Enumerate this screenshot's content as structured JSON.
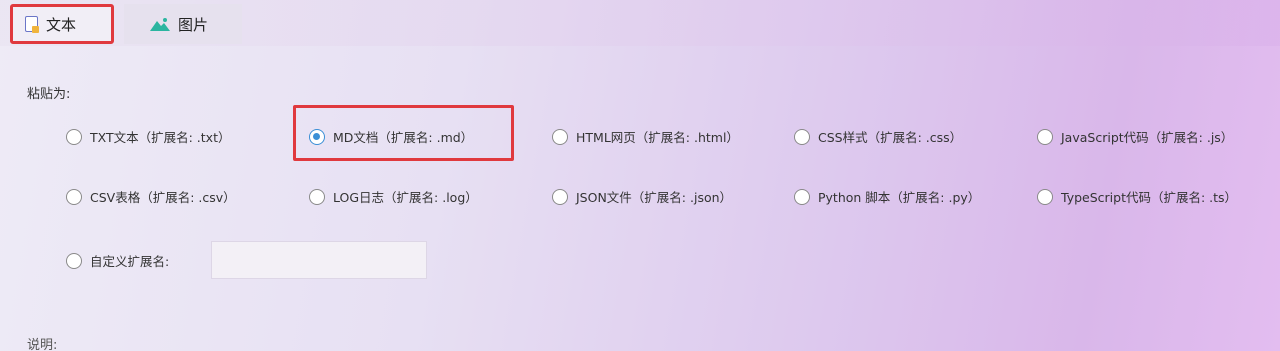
{
  "tabs": [
    {
      "label": "文本",
      "icon": "text-document-icon",
      "selected": true
    },
    {
      "label": "图片",
      "icon": "image-icon",
      "selected": false
    }
  ],
  "paste_as_label": "粘贴为:",
  "options": [
    {
      "label": "TXT文本（扩展名: .txt）",
      "checked": false
    },
    {
      "label": "MD文档（扩展名: .md）",
      "checked": true
    },
    {
      "label": "HTML网页（扩展名: .html）",
      "checked": false
    },
    {
      "label": "CSS样式（扩展名: .css）",
      "checked": false
    },
    {
      "label": "JavaScript代码（扩展名: .js）",
      "checked": false
    },
    {
      "label": "CSV表格（扩展名: .csv）",
      "checked": false
    },
    {
      "label": "LOG日志（扩展名: .log）",
      "checked": false
    },
    {
      "label": "JSON文件（扩展名: .json）",
      "checked": false
    },
    {
      "label": "Python 脚本（扩展名: .py）",
      "checked": false
    },
    {
      "label": "TypeScript代码（扩展名: .ts）",
      "checked": false
    }
  ],
  "custom_ext_label": "自定义扩展名:",
  "custom_ext_value": "",
  "description_label": "说明:",
  "colors": {
    "highlight": "#e0393e",
    "radio_checked": "#3b8fd6"
  }
}
